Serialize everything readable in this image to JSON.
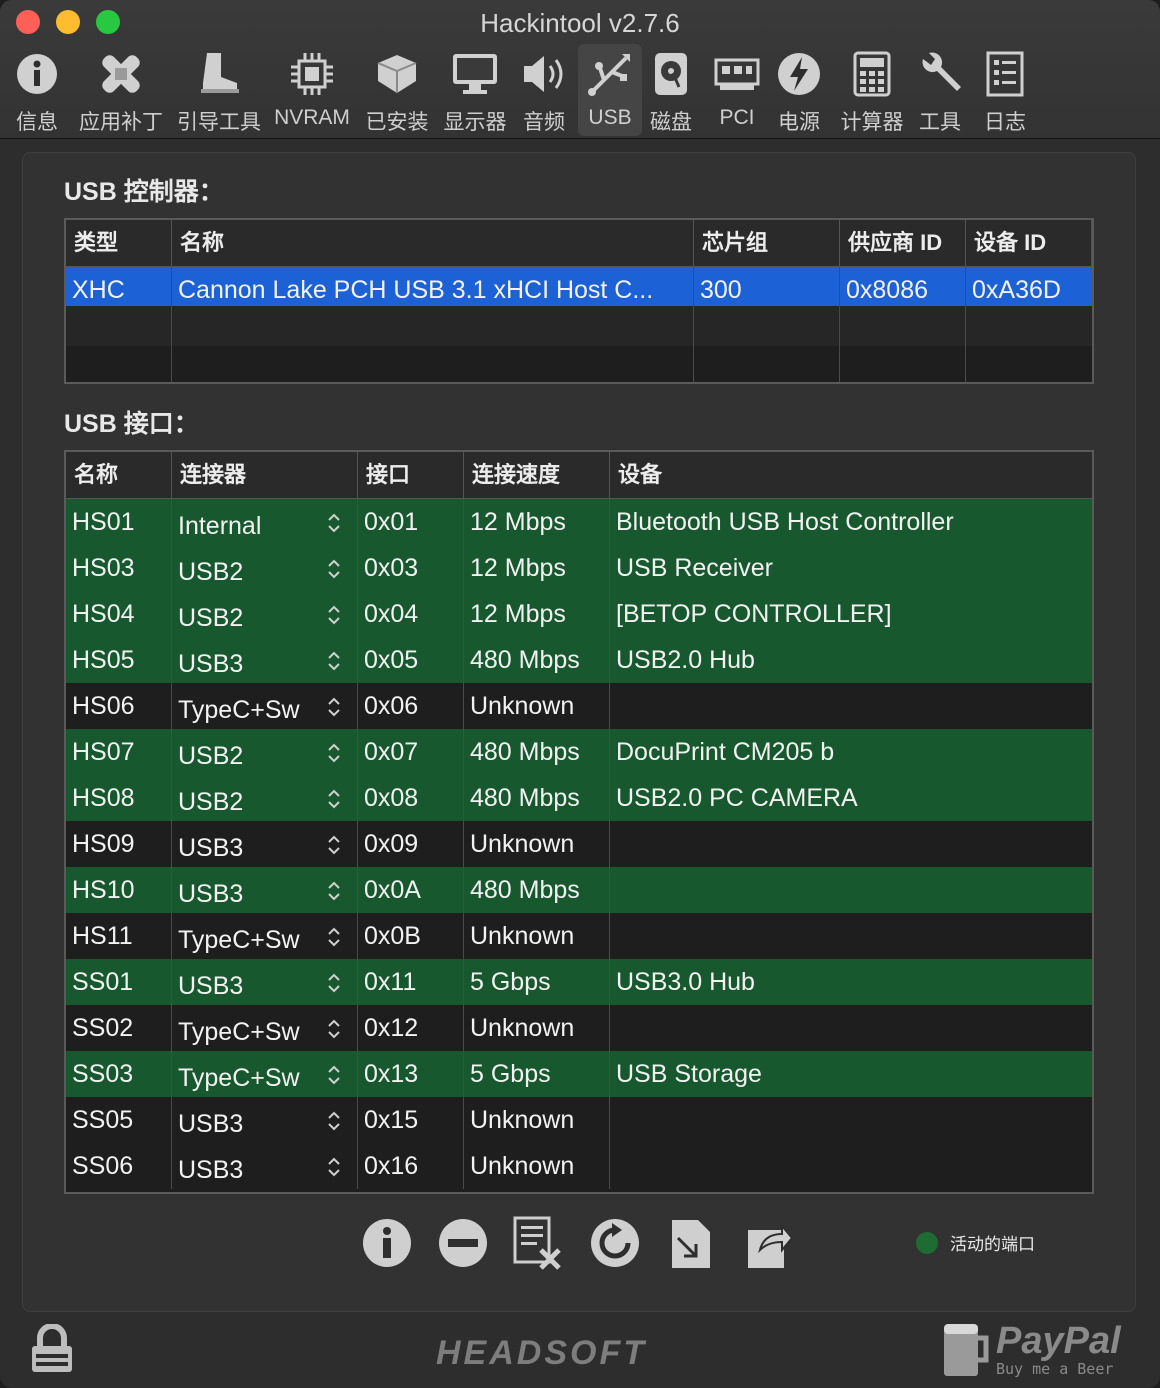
{
  "window": {
    "title": "Hackintool v2.7.6"
  },
  "toolbar": [
    {
      "label": "信息",
      "icon": "info-icon"
    },
    {
      "label": "应用补丁",
      "icon": "bandage-icon"
    },
    {
      "label": "引导工具",
      "icon": "boot-icon"
    },
    {
      "label": "NVRAM",
      "icon": "chip-icon"
    },
    {
      "label": "已安装",
      "icon": "box-icon"
    },
    {
      "label": "显示器",
      "icon": "monitor-icon"
    },
    {
      "label": "音频",
      "icon": "speaker-icon"
    },
    {
      "label": "USB",
      "icon": "usb-icon",
      "active": true
    },
    {
      "label": "磁盘",
      "icon": "disk-icon"
    },
    {
      "label": "PCI",
      "icon": "pci-icon"
    },
    {
      "label": "电源",
      "icon": "power-icon"
    },
    {
      "label": "计算器",
      "icon": "calculator-icon"
    },
    {
      "label": "工具",
      "icon": "wrench-icon"
    },
    {
      "label": "日志",
      "icon": "log-icon"
    }
  ],
  "controllers": {
    "title": "USB 控制器：",
    "headers": [
      "类型",
      "名称",
      "芯片组",
      "供应商 ID",
      "设备 ID"
    ],
    "rows": [
      {
        "type": "XHC",
        "name": "Cannon Lake PCH USB 3.1 xHCI Host C...",
        "chipset": "300",
        "vendor_id": "0x8086",
        "device_id": "0xA36D",
        "selected": true
      }
    ]
  },
  "ports": {
    "title": "USB 接口：",
    "headers": [
      "名称",
      "连接器",
      "接口",
      "连接速度",
      "设备"
    ],
    "rows": [
      {
        "name": "HS01",
        "connector": "Internal",
        "port": "0x01",
        "speed": "12 Mbps",
        "device": "Bluetooth USB Host Controller",
        "active": true
      },
      {
        "name": "HS03",
        "connector": "USB2",
        "port": "0x03",
        "speed": "12 Mbps",
        "device": "USB Receiver",
        "active": true
      },
      {
        "name": "HS04",
        "connector": "USB2",
        "port": "0x04",
        "speed": "12 Mbps",
        "device": "[BETOP CONTROLLER]",
        "active": true
      },
      {
        "name": "HS05",
        "connector": "USB3",
        "port": "0x05",
        "speed": "480 Mbps",
        "device": "USB2.0 Hub",
        "active": true
      },
      {
        "name": "HS06",
        "connector": "TypeC+Sw",
        "port": "0x06",
        "speed": "Unknown",
        "device": "",
        "active": false
      },
      {
        "name": "HS07",
        "connector": "USB2",
        "port": "0x07",
        "speed": "480 Mbps",
        "device": "DocuPrint CM205 b",
        "active": true
      },
      {
        "name": "HS08",
        "connector": "USB2",
        "port": "0x08",
        "speed": "480 Mbps",
        "device": "USB2.0 PC CAMERA",
        "active": true
      },
      {
        "name": "HS09",
        "connector": "USB3",
        "port": "0x09",
        "speed": "Unknown",
        "device": "",
        "active": false
      },
      {
        "name": "HS10",
        "connector": "USB3",
        "port": "0x0A",
        "speed": "480 Mbps",
        "device": "",
        "active": true
      },
      {
        "name": "HS11",
        "connector": "TypeC+Sw",
        "port": "0x0B",
        "speed": "Unknown",
        "device": "",
        "active": false
      },
      {
        "name": "SS01",
        "connector": "USB3",
        "port": "0x11",
        "speed": "5 Gbps",
        "device": "USB3.0 Hub",
        "active": true
      },
      {
        "name": "SS02",
        "connector": "TypeC+Sw",
        "port": "0x12",
        "speed": "Unknown",
        "device": "",
        "active": false
      },
      {
        "name": "SS03",
        "connector": "TypeC+Sw",
        "port": "0x13",
        "speed": "5 Gbps",
        "device": "USB Storage",
        "active": true
      },
      {
        "name": "SS05",
        "connector": "USB3",
        "port": "0x15",
        "speed": "Unknown",
        "device": "",
        "active": false
      },
      {
        "name": "SS06",
        "connector": "USB3",
        "port": "0x16",
        "speed": "Unknown",
        "device": "",
        "active": false
      }
    ]
  },
  "bottom_actions": [
    "info-icon",
    "remove-icon",
    "clear-log-icon",
    "refresh-icon",
    "import-icon",
    "export-icon"
  ],
  "legend": {
    "label": "活动的端口",
    "color": "#1e6b33"
  },
  "footer": {
    "brand": "HEADSOFT",
    "paypal": "PayPal",
    "paypal_sub": "Buy me a Beer"
  },
  "colors": {
    "active_row": "#17582e",
    "selected_row": "#1c62d6",
    "inactive_row": "#1e1e1e"
  }
}
